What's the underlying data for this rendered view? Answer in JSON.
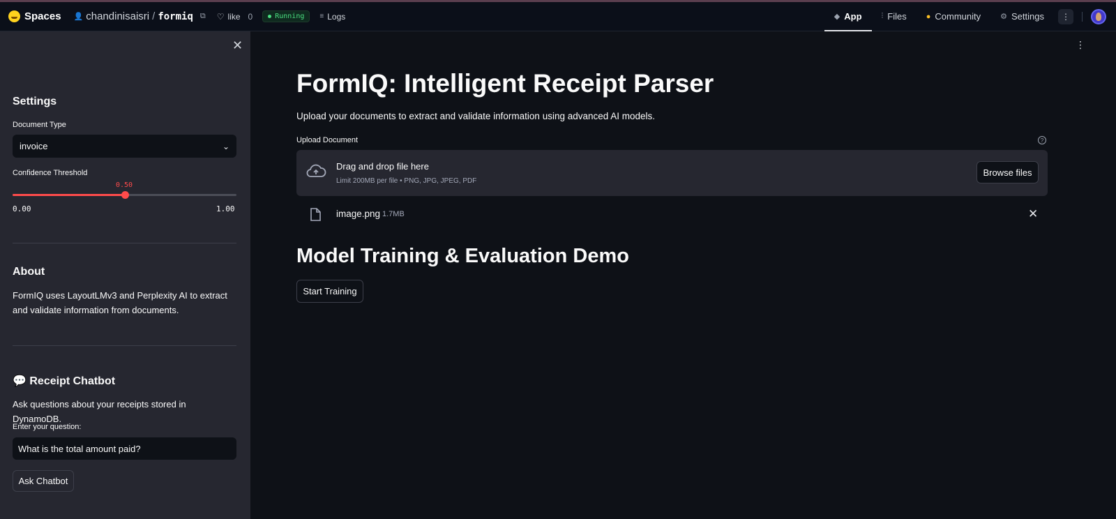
{
  "topbar": {
    "spaces_label": "Spaces",
    "owner": "chandinisaisri",
    "slash": "/",
    "repo_name": "formiq",
    "like_label": "like",
    "like_count": "0",
    "status": "Running",
    "logs_label": "Logs",
    "tabs": [
      {
        "label": "App",
        "icon": "cube-icon",
        "active": true
      },
      {
        "label": "Files",
        "icon": "files-icon",
        "active": false
      },
      {
        "label": "Community",
        "icon": "community-icon",
        "active": false
      },
      {
        "label": "Settings",
        "icon": "gear-icon",
        "active": false
      }
    ]
  },
  "sidebar": {
    "settings_heading": "Settings",
    "doc_type_label": "Document Type",
    "doc_type_value": "invoice",
    "confidence_label": "Confidence Threshold",
    "confidence_value": "0.50",
    "confidence_level": 0.5,
    "slider_min": "0.00",
    "slider_max": "1.00",
    "about_heading": "About",
    "about_text": "FormIQ uses LayoutLMv3 and Perplexity AI to extract and validate information from documents.",
    "chatbot_heading": "💬 Receipt Chatbot",
    "chatbot_desc": "Ask questions about your receipts stored in DynamoDB.",
    "question_label": "Enter your question:",
    "question_value": "What is the total amount paid?",
    "ask_button": "Ask Chatbot"
  },
  "main": {
    "title": "FormIQ: Intelligent Receipt Parser",
    "lead": "Upload your documents to extract and validate information using advanced AI models.",
    "upload_label": "Upload Document",
    "dropzone_title": "Drag and drop file here",
    "dropzone_limit": "Limit 200MB per file • PNG, JPG, JPEG, PDF",
    "browse_button": "Browse files",
    "file_name": "image.png",
    "file_size": "1.7MB",
    "section_title": "Model Training & Evaluation Demo",
    "start_button": "Start Training"
  },
  "colors": {
    "accent": "#ff4b4b",
    "background": "#0e1117",
    "sidebar": "#262730",
    "status_green": "#4ade80"
  }
}
